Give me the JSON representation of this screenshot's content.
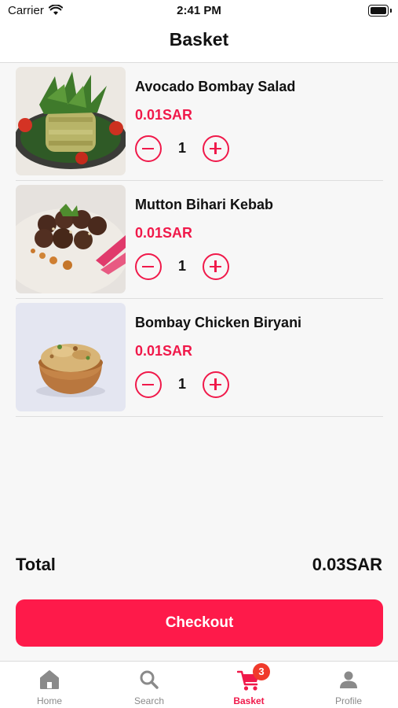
{
  "status_bar": {
    "carrier": "Carrier",
    "time": "2:41 PM"
  },
  "header": {
    "title": "Basket"
  },
  "basket": {
    "items": [
      {
        "name": "Avocado Bombay Salad",
        "price": "0.01SAR",
        "quantity": "1",
        "image_icon": "salad-photo"
      },
      {
        "name": "Mutton Bihari Kebab",
        "price": "0.01SAR",
        "quantity": "1",
        "image_icon": "kebab-photo"
      },
      {
        "name": "Bombay Chicken Biryani",
        "price": "0.01SAR",
        "quantity": "1",
        "image_icon": "biryani-photo"
      }
    ]
  },
  "summary": {
    "total_label": "Total",
    "total_value": "0.03SAR"
  },
  "checkout": {
    "label": "Checkout"
  },
  "tabs": [
    {
      "label": "Home",
      "icon": "home-icon",
      "active": false
    },
    {
      "label": "Search",
      "icon": "search-icon",
      "active": false
    },
    {
      "label": "Basket",
      "icon": "cart-icon",
      "active": true,
      "badge": "3"
    },
    {
      "label": "Profile",
      "icon": "person-icon",
      "active": false
    }
  ],
  "colors": {
    "accent": "#f0194a",
    "checkout_bg": "#fe1a4a",
    "badge": "#f03a2b",
    "inactive_tab": "#8a8a8a"
  }
}
